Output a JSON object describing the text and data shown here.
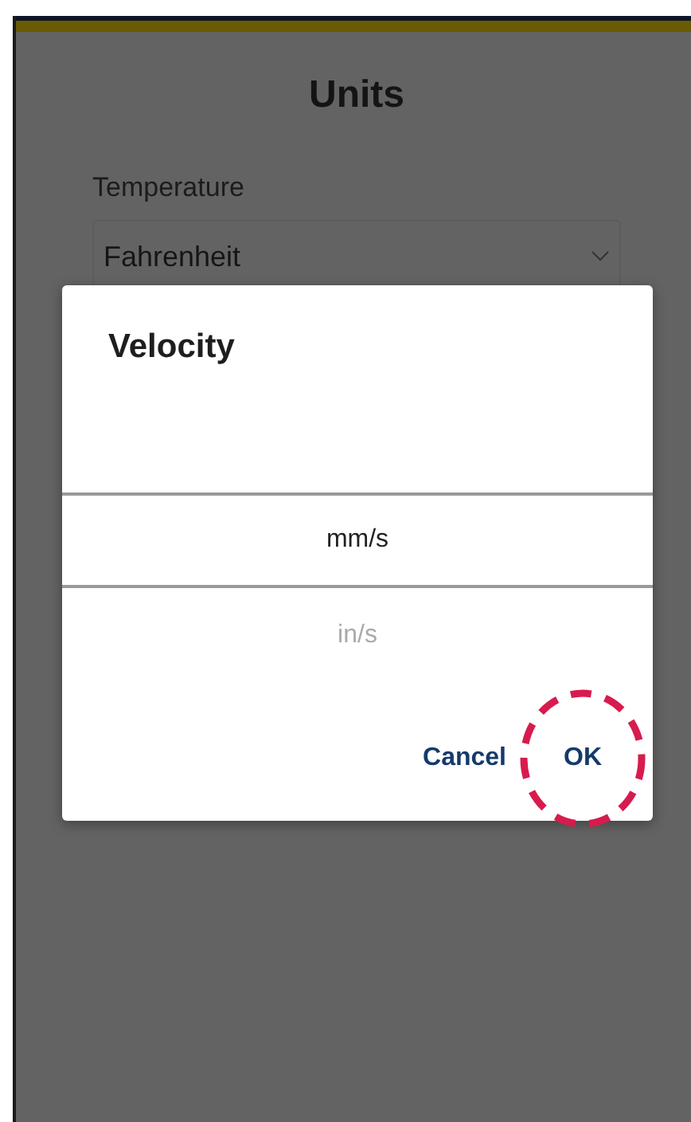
{
  "page": {
    "title": "Units",
    "fields": [
      {
        "label": "Temperature",
        "value": "Fahrenheit"
      }
    ]
  },
  "dialog": {
    "title": "Velocity",
    "options": [
      {
        "label": "mm/s",
        "selected": true
      },
      {
        "label": "in/s",
        "selected": false
      }
    ],
    "buttons": [
      {
        "label": "Cancel",
        "highlighted": false
      },
      {
        "label": "OK",
        "highlighted": true
      }
    ]
  }
}
